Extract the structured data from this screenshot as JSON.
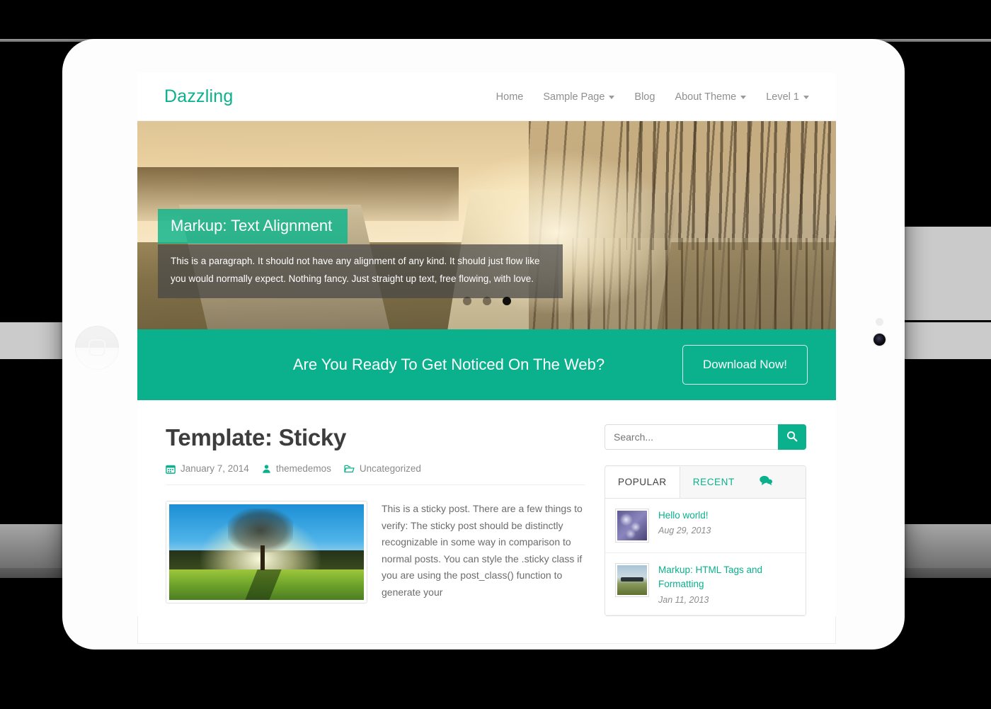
{
  "site": {
    "brand": "Dazzling",
    "nav": [
      {
        "label": "Home",
        "has_caret": false
      },
      {
        "label": "Sample Page",
        "has_caret": true
      },
      {
        "label": "Blog",
        "has_caret": false
      },
      {
        "label": "About Theme",
        "has_caret": true
      },
      {
        "label": "Level 1",
        "has_caret": true
      }
    ]
  },
  "slider": {
    "caption_title": "Markup: Text Alignment",
    "caption_body": "This is a paragraph. It should not have any alignment of any kind. It should just flow like you would normally expect. Nothing fancy. Just straight up text, free flowing, with love.",
    "dots": [
      {
        "active": false
      },
      {
        "active": false
      },
      {
        "active": true
      }
    ]
  },
  "cta": {
    "headline": "Are You Ready To Get Noticed On The Web?",
    "button_label": "Download Now!"
  },
  "post": {
    "title": "Template: Sticky",
    "meta": {
      "date": "January 7, 2014",
      "author": "themedemos",
      "category": "Uncategorized"
    },
    "body": "This is a sticky post. There are a few things to verify: The sticky post should be distinctly recognizable in some way in comparison to normal posts. You can style the .sticky class if you are using the post_class() function to generate your"
  },
  "sidebar": {
    "search": {
      "placeholder": "Search...",
      "value": "",
      "button_icon": "search-icon"
    },
    "tabs": [
      {
        "label": "POPULAR",
        "active": true
      },
      {
        "label": "RECENT",
        "active": false
      }
    ],
    "comments_tab_icon": "comment-bubble-icon",
    "popular_posts": [
      {
        "title": "Hello world!",
        "date": "Aug 29, 2013"
      },
      {
        "title": "Markup: HTML Tags and Formatting",
        "date": "Jan 11, 2013"
      }
    ]
  },
  "colors": {
    "accent": "#0ab18c",
    "heading": "#3d3d3d",
    "muted": "#8b8b8b"
  }
}
